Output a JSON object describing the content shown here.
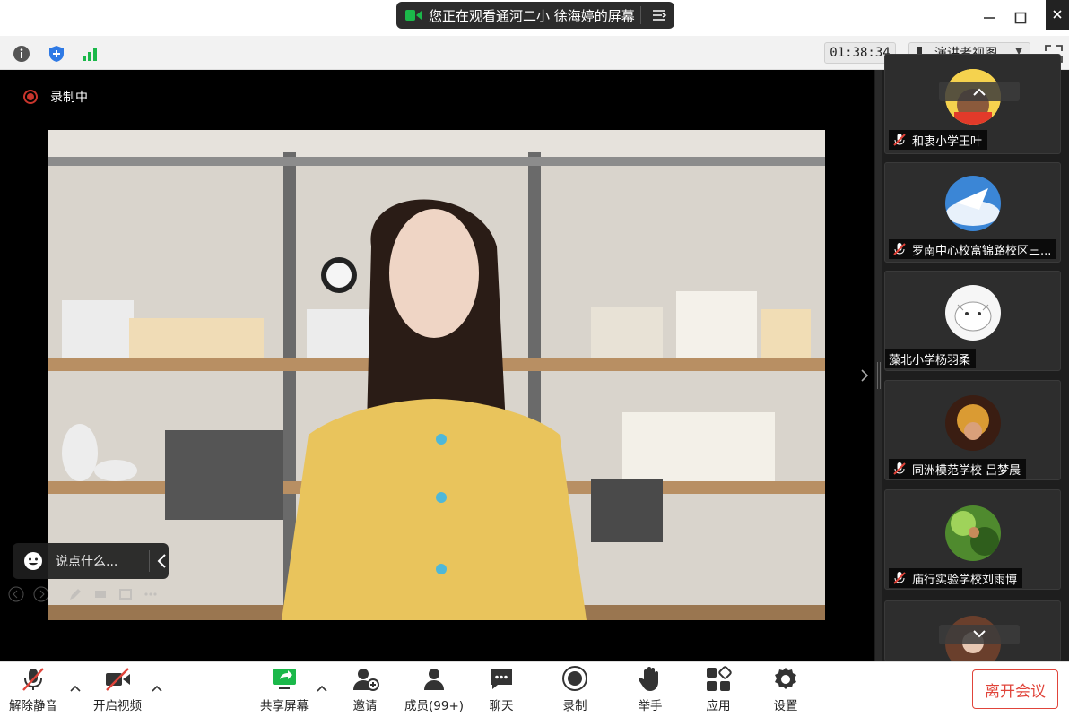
{
  "banner": {
    "text": "您正在观看通河二小 徐海婷的屏幕"
  },
  "topbar": {
    "timer": "01:38:34",
    "view_label": "演讲者视图"
  },
  "stage": {
    "recording_label": "录制中",
    "chat_placeholder": "说点什么..."
  },
  "participants": [
    {
      "name": "和衷小学王叶",
      "muted": true
    },
    {
      "name": "罗南中心校富锦路校区三...",
      "muted": true
    },
    {
      "name": "藻北小学杨羽柔",
      "muted": false
    },
    {
      "name": "同洲模范学校 吕梦晨",
      "muted": true
    },
    {
      "name": "庙行实验学校刘雨博",
      "muted": true
    }
  ],
  "toolbar": {
    "unmute": "解除静音",
    "start_video": "开启视频",
    "share_screen": "共享屏幕",
    "invite": "邀请",
    "members": "成员(99+)",
    "chat": "聊天",
    "record": "录制",
    "raise_hand": "举手",
    "apps": "应用",
    "settings": "设置",
    "leave": "离开会议"
  },
  "colors": {
    "accent_green": "#1bb84a",
    "danger_red": "#e0443a",
    "record_red": "#c9352c"
  }
}
